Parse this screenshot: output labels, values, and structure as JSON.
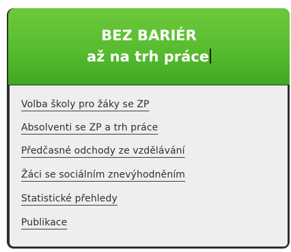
{
  "banner": {
    "line1": "BEZ BARIÉR",
    "line2": "až na trh práce"
  },
  "menu": {
    "items": [
      {
        "label": "Volba školy pro žáky se ZP"
      },
      {
        "label": "Absolventi se ZP a trh práce"
      },
      {
        "label": "Předčasné odchody ze vzdělávání"
      },
      {
        "label": "Žáci se sociálním znevýhodněním"
      },
      {
        "label": "Statistické přehledy"
      },
      {
        "label": "Publikace"
      }
    ]
  },
  "colors": {
    "banner_green": "#57bc2f",
    "menu_background": "#eeeeee",
    "frame": "#2e2e2e"
  }
}
